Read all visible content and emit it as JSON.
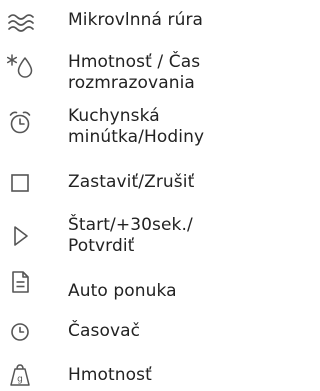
{
  "legend": {
    "items": [
      {
        "icon": "microwave-waves-icon",
        "label": "Mikrovlnná rúra"
      },
      {
        "icon": "defrost-drop-icon",
        "label": "Hmotnosť / Čas\nrozmrazovania"
      },
      {
        "icon": "kitchen-timer-clock-icon",
        "label": "Kuchynská\nminútka/Hodiny"
      },
      {
        "icon": "stop-square-icon",
        "label": "Zastaviť/Zrušiť"
      },
      {
        "icon": "start-play-icon",
        "label": "Štart/+30sek./\nPotvrdiť"
      },
      {
        "icon": "auto-menu-document-icon",
        "label": "Auto ponuka"
      },
      {
        "icon": "timer-clock-icon",
        "label": "Časovač"
      },
      {
        "icon": "weight-scale-icon",
        "label": "Hmotnosť"
      }
    ]
  },
  "colors": {
    "text": "#222222",
    "icon": "#555555"
  }
}
